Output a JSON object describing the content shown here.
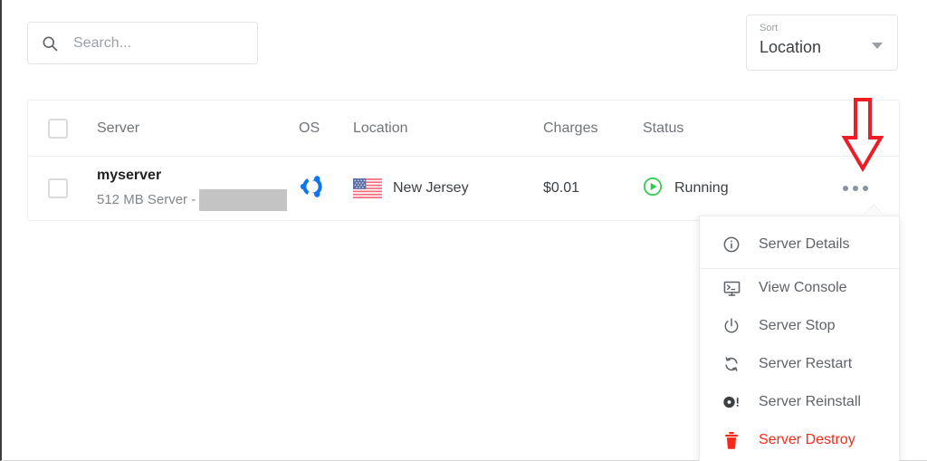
{
  "search": {
    "icon": "search-icon",
    "value": "",
    "placeholder": "Search..."
  },
  "sort": {
    "label": "Sort",
    "value": "Location",
    "caret_icon": "chevron-down-icon"
  },
  "table": {
    "headers": {
      "server": "Server",
      "os": "OS",
      "location": "Location",
      "charges": "Charges",
      "status": "Status"
    },
    "rows": [
      {
        "name": "myserver",
        "plan": "512 MB Server -",
        "plan_redacted": true,
        "os_icon": "ubuntu-icon",
        "flag_icon": "us-flag-icon",
        "location": "New Jersey",
        "charges": "$0.01",
        "status": "Running",
        "status_icon": "play-circle-icon",
        "status_color": "#2ecc4a",
        "actions_icon": "more-options-icon"
      }
    ]
  },
  "menu": {
    "items": [
      {
        "icon": "info-circle-icon",
        "label": "Server Details",
        "danger": false
      },
      {
        "icon": "console-monitor-icon",
        "label": "View Console",
        "danger": false
      },
      {
        "icon": "power-icon",
        "label": "Server Stop",
        "danger": false
      },
      {
        "icon": "refresh-icon",
        "label": "Server Restart",
        "danger": false
      },
      {
        "icon": "disc-alert-icon",
        "label": "Server Reinstall",
        "danger": false
      },
      {
        "icon": "trash-icon",
        "label": "Server Destroy",
        "danger": true
      }
    ]
  },
  "annotation": {
    "arrow_icon": "red-down-arrow-annotation",
    "color": "#ee1c25"
  }
}
